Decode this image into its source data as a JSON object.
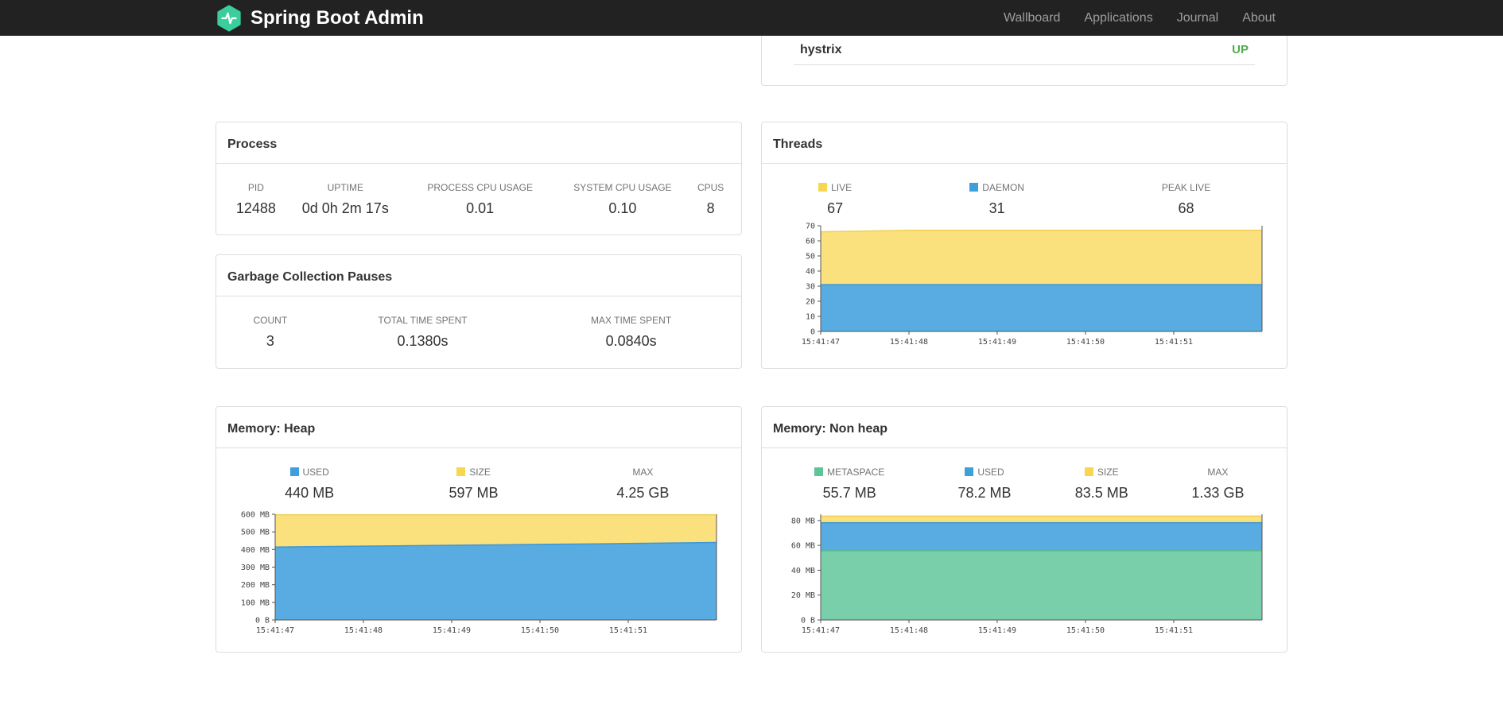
{
  "navbar": {
    "brand": "Spring Boot Admin",
    "links": [
      {
        "label": "Wallboard"
      },
      {
        "label": "Applications"
      },
      {
        "label": "Journal"
      },
      {
        "label": "About"
      }
    ],
    "brand_color": "#3ace9d"
  },
  "application_panel": {
    "name": "hystrix",
    "status": "UP",
    "status_color": "#4cae4c"
  },
  "panels": {
    "process": {
      "title": "Process",
      "metrics": [
        {
          "label": "PID",
          "value": "12488"
        },
        {
          "label": "UPTIME",
          "value": "0d 0h 2m 17s"
        },
        {
          "label": "PROCESS CPU USAGE",
          "value": "0.01"
        },
        {
          "label": "SYSTEM CPU USAGE",
          "value": "0.10"
        },
        {
          "label": "CPUS",
          "value": "8"
        }
      ]
    },
    "gc": {
      "title": "Garbage Collection Pauses",
      "metrics": [
        {
          "label": "COUNT",
          "value": "3"
        },
        {
          "label": "TOTAL TIME SPENT",
          "value": "0.1380s"
        },
        {
          "label": "MAX TIME SPENT",
          "value": "0.0840s"
        }
      ]
    },
    "threads": {
      "title": "Threads",
      "legend": [
        {
          "label": "LIVE",
          "value": "67",
          "swatch": "#f7d74f"
        },
        {
          "label": "DAEMON",
          "value": "31",
          "swatch": "#3e9fdb"
        },
        {
          "label": "PEAK LIVE",
          "value": "68"
        }
      ]
    },
    "heap": {
      "title": "Memory: Heap",
      "legend": [
        {
          "label": "USED",
          "value": "440 MB",
          "swatch": "#3e9fdb"
        },
        {
          "label": "SIZE",
          "value": "597 MB",
          "swatch": "#f7d74f"
        },
        {
          "label": "MAX",
          "value": "4.25 GB"
        }
      ]
    },
    "nonheap": {
      "title": "Memory: Non heap",
      "legend": [
        {
          "label": "METASPACE",
          "value": "55.7 MB",
          "swatch": "#5fc495"
        },
        {
          "label": "USED",
          "value": "78.2 MB",
          "swatch": "#3e9fdb"
        },
        {
          "label": "SIZE",
          "value": "83.5 MB",
          "swatch": "#f7d74f"
        },
        {
          "label": "MAX",
          "value": "1.33 GB"
        }
      ]
    }
  },
  "chart_data": [
    {
      "id": "threads",
      "type": "area",
      "title": "Threads",
      "x_labels": [
        "15:41:47",
        "15:41:48",
        "15:41:49",
        "15:41:50",
        "15:41:51"
      ],
      "ylim": [
        0,
        70
      ],
      "y_ticks": [
        {
          "v": 0,
          "label": "0"
        },
        {
          "v": 10,
          "label": "10"
        },
        {
          "v": 20,
          "label": "20"
        },
        {
          "v": 30,
          "label": "30"
        },
        {
          "v": 40,
          "label": "40"
        },
        {
          "v": 50,
          "label": "50"
        },
        {
          "v": 60,
          "label": "60"
        },
        {
          "v": 70,
          "label": "70"
        }
      ],
      "layers": [
        {
          "name": "LIVE",
          "fill": "#fbe17d",
          "stroke": "#f0cf54",
          "values": [
            66,
            67,
            67,
            67,
            67,
            67
          ]
        },
        {
          "name": "DAEMON",
          "fill": "#58ace2",
          "stroke": "#3b97d6",
          "values": [
            31,
            31,
            31,
            31,
            31,
            31
          ]
        }
      ]
    },
    {
      "id": "heap",
      "type": "area",
      "title": "Memory: Heap",
      "x_labels": [
        "15:41:47",
        "15:41:48",
        "15:41:49",
        "15:41:50",
        "15:41:51"
      ],
      "ylim": [
        0,
        600
      ],
      "y_ticks": [
        {
          "v": 0,
          "label": "0 B"
        },
        {
          "v": 100,
          "label": "100 MB"
        },
        {
          "v": 200,
          "label": "200 MB"
        },
        {
          "v": 300,
          "label": "300 MB"
        },
        {
          "v": 400,
          "label": "400 MB"
        },
        {
          "v": 500,
          "label": "500 MB"
        },
        {
          "v": 600,
          "label": "600 MB"
        }
      ],
      "layers": [
        {
          "name": "SIZE",
          "fill": "#fbe17d",
          "stroke": "#f0cf54",
          "values": [
            597,
            597,
            597,
            597,
            597,
            597
          ]
        },
        {
          "name": "USED",
          "fill": "#58ace2",
          "stroke": "#3b97d6",
          "values": [
            414,
            419,
            424,
            429,
            434,
            440
          ]
        }
      ]
    },
    {
      "id": "nonheap",
      "type": "area",
      "title": "Memory: Non heap",
      "x_labels": [
        "15:41:47",
        "15:41:48",
        "15:41:49",
        "15:41:50",
        "15:41:51"
      ],
      "ylim": [
        0,
        85
      ],
      "y_ticks": [
        {
          "v": 0,
          "label": "0 B"
        },
        {
          "v": 20,
          "label": "20 MB"
        },
        {
          "v": 40,
          "label": "40 MB"
        },
        {
          "v": 60,
          "label": "60 MB"
        },
        {
          "v": 80,
          "label": "80 MB"
        }
      ],
      "layers": [
        {
          "name": "SIZE",
          "fill": "#fbe17d",
          "stroke": "#f0cf54",
          "values": [
            83.5,
            83.5,
            83.5,
            83.5,
            83.5,
            83.5
          ]
        },
        {
          "name": "USED",
          "fill": "#58ace2",
          "stroke": "#3b97d6",
          "values": [
            78.2,
            78.2,
            78.2,
            78.2,
            78.2,
            78.2
          ]
        },
        {
          "name": "METASPACE",
          "fill": "#79cfa9",
          "stroke": "#55bd8e",
          "values": [
            55.7,
            55.7,
            55.7,
            55.7,
            55.7,
            55.7
          ]
        }
      ]
    }
  ]
}
